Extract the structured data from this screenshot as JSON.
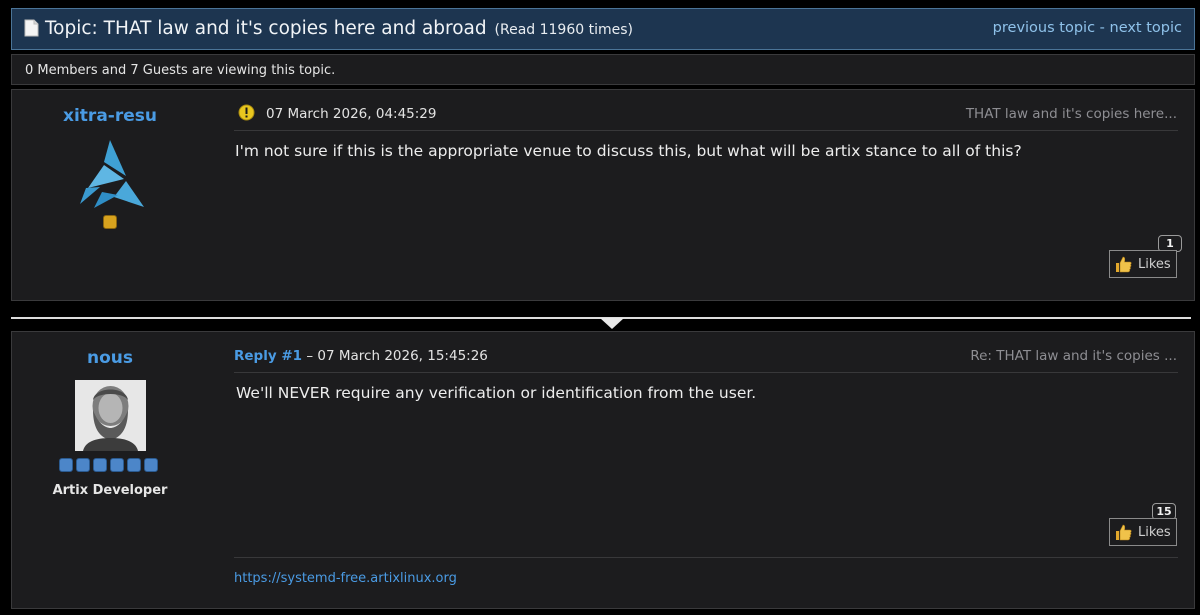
{
  "topbar": {
    "title": "Topic: THAT law and it's copies here and abroad",
    "read_count": "(Read 11960 times)",
    "prev_label": "previous topic",
    "separator": "-",
    "next_label": "next topic"
  },
  "viewers": {
    "text": "0 Members and 7 Guests are viewing this topic."
  },
  "posts": [
    {
      "author": "xitra-resu",
      "timestamp": "07 March 2026, 04:45:29",
      "subject": "THAT law and it's copies here...",
      "body": "I'm not sure if this is the appropriate venue to discuss this, but what will be artix stance to all of this?",
      "likes_count": "1",
      "likes_label": "Likes"
    },
    {
      "author": "nous",
      "reply_label": "Reply #1",
      "timestamp": "– 07 March 2026, 15:45:26",
      "subject": "Re: THAT law and it's copies ...",
      "body": "We'll NEVER require any verification or identification from the user.",
      "role": "Artix Developer",
      "likes_count": "15",
      "likes_label": "Likes",
      "signature_link": "https://systemd-free.artixlinux.org"
    }
  ],
  "colors": {
    "accent_link": "#4a9be4",
    "topbar_bg": "#1d3550",
    "panel_bg": "#1c1c1e"
  }
}
